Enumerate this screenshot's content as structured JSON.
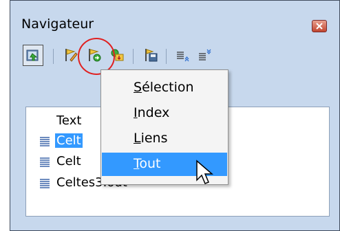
{
  "window": {
    "title": "Navigateur"
  },
  "toolbar": {
    "buttons": [
      {
        "icon": "toggle-navigator-icon",
        "pressed": true
      },
      {
        "icon": "edit-link-icon"
      },
      {
        "icon": "insert-mode-icon"
      },
      {
        "icon": "promote-icon"
      },
      {
        "icon": "save-as-icon"
      },
      {
        "icon": "show-chapter-up-icon"
      },
      {
        "icon": "show-chapter-down-icon"
      }
    ]
  },
  "tree": {
    "items": [
      {
        "label": "Text"
      },
      {
        "label": "Celt",
        "selected": true
      },
      {
        "label": "Celt"
      },
      {
        "label": "Celtes3.odt"
      }
    ]
  },
  "menu": {
    "items": [
      {
        "mnemonic": "S",
        "rest": "élection"
      },
      {
        "mnemonic": "I",
        "rest": "ndex"
      },
      {
        "mnemonic": "L",
        "rest": "iens"
      },
      {
        "mnemonic": "T",
        "rest": "out",
        "highlighted": true
      }
    ]
  },
  "colors": {
    "window_bg": "#c7d8ed",
    "selection": "#3399ff",
    "annotation_circle": "#e02020"
  }
}
